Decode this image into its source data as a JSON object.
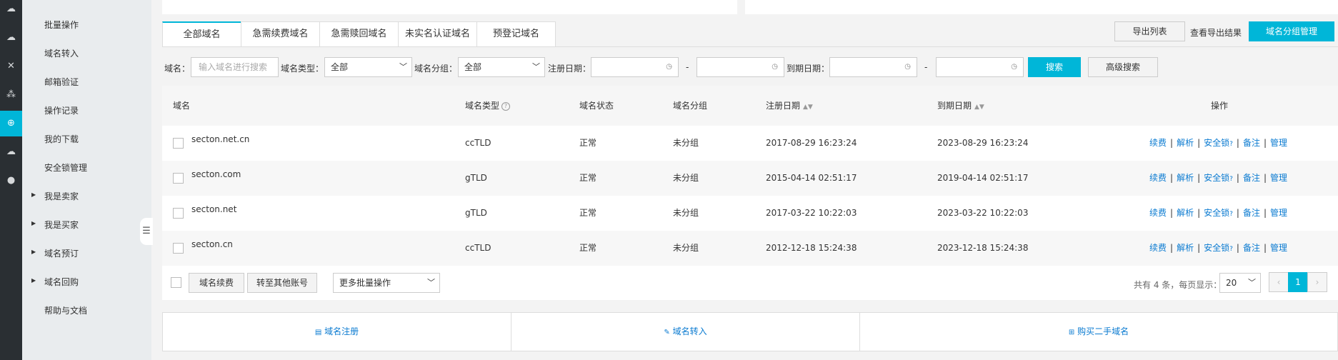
{
  "sidebar": {
    "items": [
      {
        "label": "批量操作",
        "expandable": false
      },
      {
        "label": "域名转入",
        "expandable": false
      },
      {
        "label": "邮箱验证",
        "expandable": false
      },
      {
        "label": "操作记录",
        "expandable": false
      },
      {
        "label": "我的下载",
        "expandable": false
      },
      {
        "label": "安全锁管理",
        "expandable": false
      },
      {
        "label": "我是卖家",
        "expandable": true
      },
      {
        "label": "我是买家",
        "expandable": true
      },
      {
        "label": "域名预订",
        "expandable": true
      },
      {
        "label": "域名回购",
        "expandable": true
      },
      {
        "label": "帮助与文档",
        "expandable": false
      }
    ]
  },
  "iconbar": {
    "icons": [
      "cloud-icon",
      "cloud-upload-icon",
      "network-icon",
      "nodes-icon",
      "globe-icon",
      "cloud-settings-icon",
      "circle-icon"
    ]
  },
  "tabs": [
    "全部域名",
    "急需续费域名",
    "急需赎回域名",
    "未实名认证域名",
    "预登记域名"
  ],
  "toolbar": {
    "export_label": "导出列表",
    "view_export_label": "查看导出结果",
    "group_manage_label": "域名分组管理"
  },
  "filters": {
    "domain_label": "域名：",
    "domain_placeholder": "输入域名进行搜索",
    "type_label": "域名类型：",
    "type_value": "全部",
    "group_label": "域名分组：",
    "group_value": "全部",
    "reg_date_label": "注册日期：",
    "expire_date_label": "到期日期：",
    "dash": "-",
    "search_label": "搜索",
    "advanced_label": "高级搜索"
  },
  "table": {
    "columns": [
      "域名",
      "域名类型",
      "域名状态",
      "域名分组",
      "注册日期",
      "到期日期",
      "操作"
    ],
    "rows": [
      {
        "domain": "secton.net.cn",
        "type": "ccTLD",
        "status": "正常",
        "group": "未分组",
        "reg": "2017-08-29 16:23:24",
        "exp": "2023-08-29 16:23:24"
      },
      {
        "domain": "secton.com",
        "type": "gTLD",
        "status": "正常",
        "group": "未分组",
        "reg": "2015-04-14 02:51:17",
        "exp": "2019-04-14 02:51:17"
      },
      {
        "domain": "secton.net",
        "type": "gTLD",
        "status": "正常",
        "group": "未分组",
        "reg": "2017-03-22 10:22:03",
        "exp": "2023-03-22 10:22:03"
      },
      {
        "domain": "secton.cn",
        "type": "ccTLD",
        "status": "正常",
        "group": "未分组",
        "reg": "2012-12-18 15:24:38",
        "exp": "2023-12-18 15:24:38"
      }
    ],
    "actions": [
      "续费",
      "解析",
      "安全锁",
      "备注",
      "管理"
    ],
    "action_sep": "|"
  },
  "footer": {
    "renew_label": "域名续费",
    "transfer_account_label": "转至其他账号",
    "more_batch_label": "更多批量操作",
    "total_text": "共有 4 条，每页显示：",
    "page_size": "20",
    "current_page": "1",
    "prev": "‹",
    "next": "›"
  },
  "quick_links": [
    {
      "label": "域名注册",
      "icon": "register-icon"
    },
    {
      "label": "域名转入",
      "icon": "pencil-icon"
    },
    {
      "label": "购买二手域名",
      "icon": "cart-icon"
    }
  ],
  "colors": {
    "accent": "#00b6d8",
    "link": "#0b7bd1",
    "sidebar_dark": "#2a2f33"
  }
}
